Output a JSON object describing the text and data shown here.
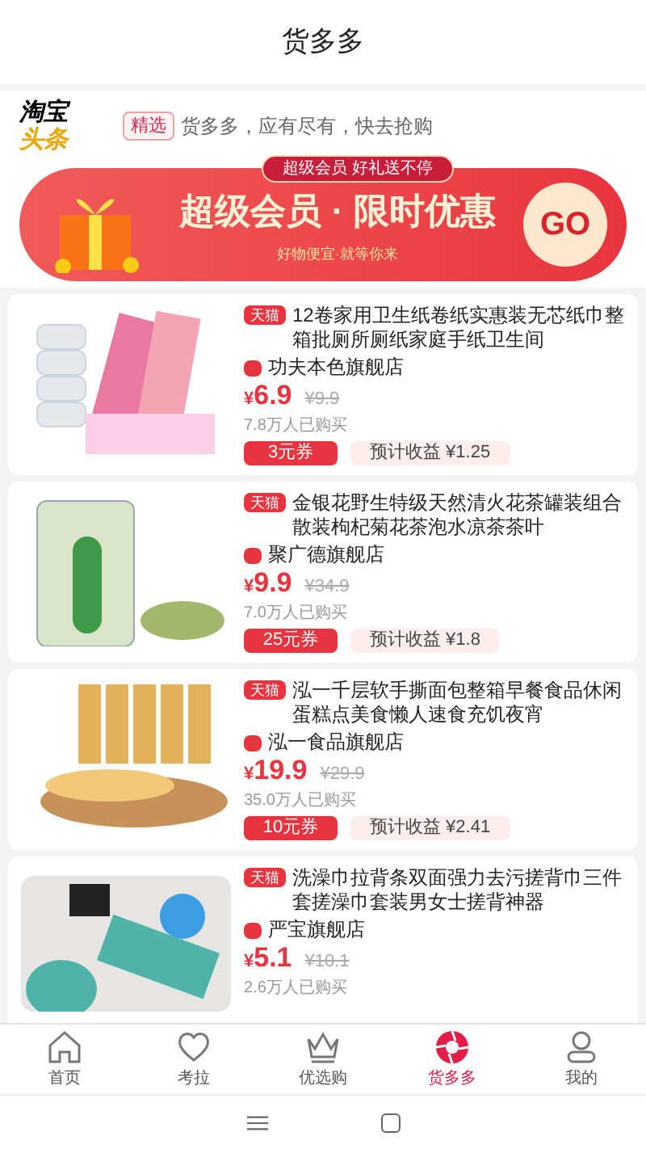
{
  "header": {
    "title": "货多多"
  },
  "headline": {
    "logo_top": "淘宝",
    "logo_bottom": "头条",
    "tag": "精选",
    "text": "货多多，应有尽有，快去抢购"
  },
  "banner": {
    "ribbon": "超级会员 好礼送不停",
    "title": "超级会员 · 限时优惠",
    "subtitle": "好物便宜·就等你来",
    "button": "GO"
  },
  "products": [
    {
      "kind": "toilet-paper",
      "platform": "天猫",
      "title": "12卷家用卫生纸卷纸实惠装无芯纸巾整箱批厕所厕纸家庭手纸卫生间",
      "shop": "功夫本色旗舰店",
      "price": "6.9",
      "currency": "¥",
      "original_price": "¥9.9",
      "sold": "7.8万人已购买",
      "coupon": "3元券",
      "earning": "预计收益 ¥1.25"
    },
    {
      "kind": "tea-jar",
      "platform": "天猫",
      "title": "金银花野生特级天然清火花茶罐装组合散装枸杞菊花茶泡水凉茶茶叶",
      "shop": "聚广德旗舰店",
      "price": "9.9",
      "currency": "¥",
      "original_price": "¥34.9",
      "sold": "7.0万人已购买",
      "coupon": "25元券",
      "earning": "预计收益 ¥1.8"
    },
    {
      "kind": "bread",
      "platform": "天猫",
      "title": "泓一千层软手撕面包整箱早餐食品休闲蛋糕点美食懒人速食充饥夜宵",
      "shop": "泓一食品旗舰店",
      "price": "19.9",
      "currency": "¥",
      "original_price": "¥29.9",
      "sold": "35.0万人已购买",
      "coupon": "10元券",
      "earning": "预计收益 ¥2.41"
    },
    {
      "kind": "bath-towel",
      "platform": "天猫",
      "title": "洗澡巾拉背条双面强力去污搓背巾三件套搓澡巾套装男女士搓背神器",
      "shop": "严宝旗舰店",
      "price": "5.1",
      "currency": "¥",
      "original_price": "¥10.1",
      "sold": "2.6万人已购买"
    }
  ],
  "tabs": [
    {
      "kind": "home",
      "label": "首页",
      "selected": false
    },
    {
      "kind": "heart",
      "label": "考拉",
      "selected": false
    },
    {
      "kind": "crown",
      "label": "优选购",
      "selected": false
    },
    {
      "kind": "aperture",
      "label": "货多多",
      "selected": true
    },
    {
      "kind": "person",
      "label": "我的",
      "selected": false
    }
  ]
}
